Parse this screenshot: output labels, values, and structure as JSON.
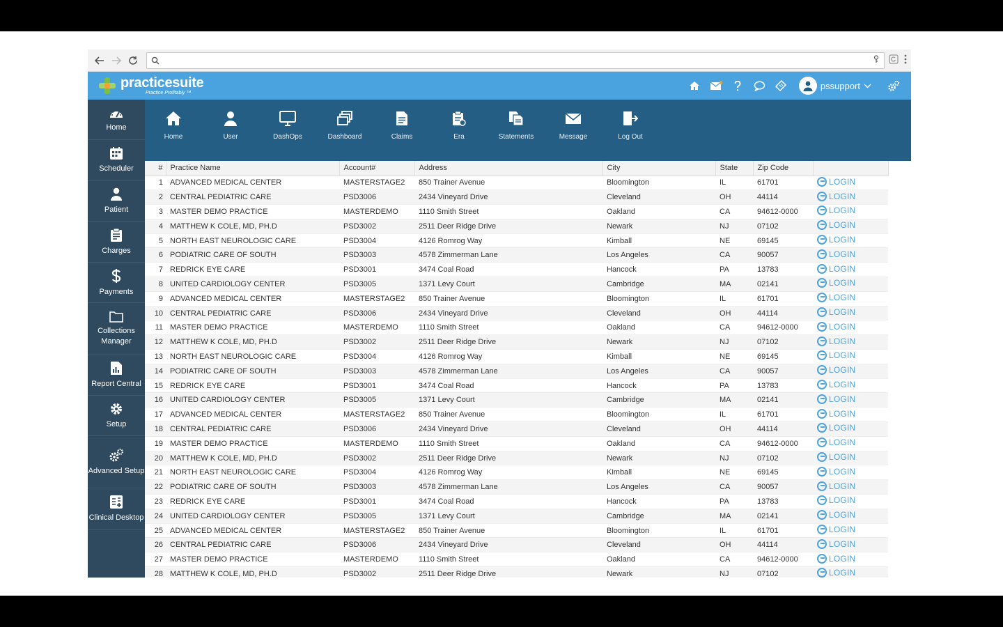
{
  "browser": {
    "url_placeholder": ""
  },
  "header": {
    "logo_name": "practicesuite",
    "logo_tagline": "Practice Profitably ™",
    "username": "pssupport"
  },
  "sidebar": {
    "items": [
      {
        "label": "Home"
      },
      {
        "label": "Scheduler"
      },
      {
        "label": "Patient"
      },
      {
        "label": "Charges"
      },
      {
        "label": "Payments"
      },
      {
        "label": "Collections Manager"
      },
      {
        "label": "Report Central"
      },
      {
        "label": "Setup"
      },
      {
        "label": "Advanced Setup"
      },
      {
        "label": "Clinical Desktop"
      }
    ]
  },
  "toolbar": {
    "items": [
      {
        "label": "Home"
      },
      {
        "label": "User"
      },
      {
        "label": "DashOps"
      },
      {
        "label": "Dashboard"
      },
      {
        "label": "Claims"
      },
      {
        "label": "Era"
      },
      {
        "label": "Statements"
      },
      {
        "label": "Message"
      },
      {
        "label": "Log Out"
      }
    ]
  },
  "table": {
    "columns": [
      "#",
      "Practice Name",
      "Account#",
      "Address",
      "City",
      "State",
      "Zip Code"
    ],
    "login_label": "LOGIN",
    "rows": [
      [
        "1",
        "ADVANCED MEDICAL CENTER",
        "MASTERSTAGE2",
        "850 Trainer Avenue",
        "Bloomington",
        "IL",
        "61701"
      ],
      [
        "2",
        "CENTRAL PEDIATRIC CARE",
        "PSD3006",
        "2434 Vineyard Drive",
        "Cleveland",
        "OH",
        "44114"
      ],
      [
        "3",
        "MASTER DEMO PRACTICE",
        "MASTERDEMO",
        "1110 Smith Street",
        "Oakland",
        "CA",
        "94612-0000"
      ],
      [
        "4",
        "MATTHEW K COLE, MD, PH.D",
        "PSD3002",
        "2511 Deer Ridge Drive",
        "Newark",
        "NJ",
        "07102"
      ],
      [
        "5",
        "NORTH EAST NEUROLOGIC CARE",
        "PSD3004",
        "4126 Romrog Way",
        "Kimball",
        "NE",
        "69145"
      ],
      [
        "6",
        "PODIATRIC CARE OF SOUTH",
        "PSD3003",
        "4578 Zimmerman Lane",
        "Los Angeles",
        "CA",
        "90057"
      ],
      [
        "7",
        "REDRICK EYE CARE",
        "PSD3001",
        "3474 Coal Road",
        "Hancock",
        "PA",
        "13783"
      ],
      [
        "8",
        "UNITED CARDIOLOGY CENTER",
        "PSD3005",
        "1371 Levy Court",
        "Cambridge",
        "MA",
        "02141"
      ],
      [
        "9",
        "ADVANCED MEDICAL CENTER",
        "MASTERSTAGE2",
        "850 Trainer Avenue",
        "Bloomington",
        "IL",
        "61701"
      ],
      [
        "10",
        "CENTRAL PEDIATRIC CARE",
        "PSD3006",
        "2434 Vineyard Drive",
        "Cleveland",
        "OH",
        "44114"
      ],
      [
        "11",
        "MASTER DEMO PRACTICE",
        "MASTERDEMO",
        "1110 Smith Street",
        "Oakland",
        "CA",
        "94612-0000"
      ],
      [
        "12",
        "MATTHEW K COLE, MD, PH.D",
        "PSD3002",
        "2511 Deer Ridge Drive",
        "Newark",
        "NJ",
        "07102"
      ],
      [
        "13",
        "NORTH EAST NEUROLOGIC CARE",
        "PSD3004",
        "4126 Romrog Way",
        "Kimball",
        "NE",
        "69145"
      ],
      [
        "14",
        "PODIATRIC CARE OF SOUTH",
        "PSD3003",
        "4578 Zimmerman Lane",
        "Los Angeles",
        "CA",
        "90057"
      ],
      [
        "15",
        "REDRICK EYE CARE",
        "PSD3001",
        "3474 Coal Road",
        "Hancock",
        "PA",
        "13783"
      ],
      [
        "16",
        "UNITED CARDIOLOGY CENTER",
        "PSD3005",
        "1371 Levy Court",
        "Cambridge",
        "MA",
        "02141"
      ],
      [
        "17",
        "ADVANCED MEDICAL CENTER",
        "MASTERSTAGE2",
        "850 Trainer Avenue",
        "Bloomington",
        "IL",
        "61701"
      ],
      [
        "18",
        "CENTRAL PEDIATRIC CARE",
        "PSD3006",
        "2434 Vineyard Drive",
        "Cleveland",
        "OH",
        "44114"
      ],
      [
        "19",
        "MASTER DEMO PRACTICE",
        "MASTERDEMO",
        "1110 Smith Street",
        "Oakland",
        "CA",
        "94612-0000"
      ],
      [
        "20",
        "MATTHEW K COLE, MD, PH.D",
        "PSD3002",
        "2511 Deer Ridge Drive",
        "Newark",
        "NJ",
        "07102"
      ],
      [
        "21",
        "NORTH EAST NEUROLOGIC CARE",
        "PSD3004",
        "4126 Romrog Way",
        "Kimball",
        "NE",
        "69145"
      ],
      [
        "22",
        "PODIATRIC CARE OF SOUTH",
        "PSD3003",
        "4578 Zimmerman Lane",
        "Los Angeles",
        "CA",
        "90057"
      ],
      [
        "23",
        "REDRICK EYE CARE",
        "PSD3001",
        "3474 Coal Road",
        "Hancock",
        "PA",
        "13783"
      ],
      [
        "24",
        "UNITED CARDIOLOGY CENTER",
        "PSD3005",
        "1371 Levy Court",
        "Cambridge",
        "MA",
        "02141"
      ],
      [
        "25",
        "ADVANCED MEDICAL CENTER",
        "MASTERSTAGE2",
        "850 Trainer Avenue",
        "Bloomington",
        "IL",
        "61701"
      ],
      [
        "26",
        "CENTRAL PEDIATRIC CARE",
        "PSD3006",
        "2434 Vineyard Drive",
        "Cleveland",
        "OH",
        "44114"
      ],
      [
        "27",
        "MASTER DEMO PRACTICE",
        "MASTERDEMO",
        "1110 Smith Street",
        "Oakland",
        "CA",
        "94612-0000"
      ],
      [
        "28",
        "MATTHEW K COLE, MD, PH.D",
        "PSD3002",
        "2511 Deer Ridge Drive",
        "Newark",
        "NJ",
        "07102"
      ]
    ]
  },
  "colors": {
    "header": "#4aa3df",
    "sidebar": "#2f4a5e",
    "toolbar": "#245e85",
    "login": "#4aa3df"
  }
}
